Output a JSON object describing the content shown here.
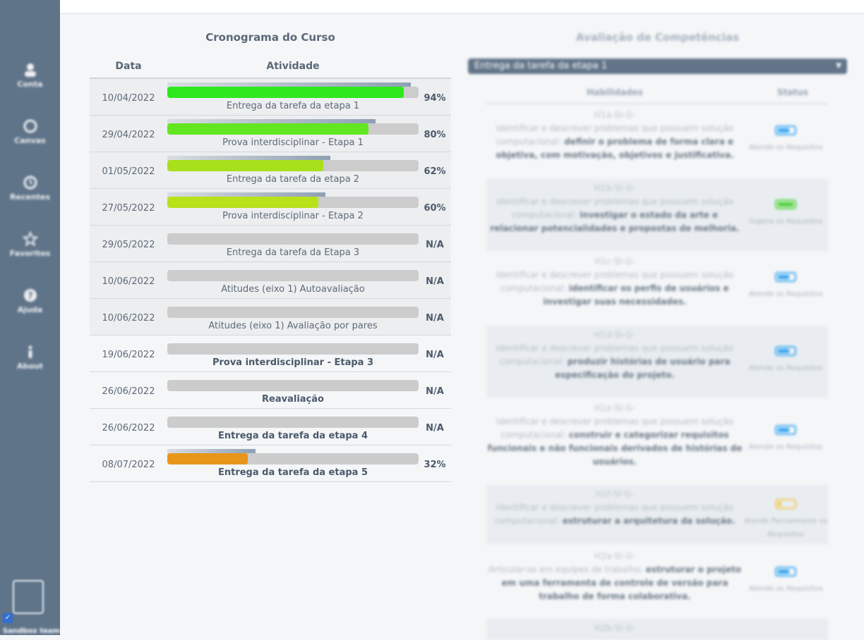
{
  "sidebar": {
    "items": [
      {
        "label": "Conta",
        "icon": "user-icon"
      },
      {
        "label": "Canvas",
        "icon": "circle-icon"
      },
      {
        "label": "Recentes",
        "icon": "clock-icon"
      },
      {
        "label": "Favoritos",
        "icon": "star-icon"
      },
      {
        "label": "Ajuda",
        "icon": "help-icon"
      },
      {
        "label": "About",
        "icon": "info-icon"
      }
    ],
    "bottom_label": "Sandbox team"
  },
  "schedule": {
    "title": "Cronograma do Curso",
    "col_date": "Data",
    "col_activity": "Atividade",
    "rows": [
      {
        "date": "10/04/2022",
        "activity": "Entrega da tarefa da etapa 1",
        "pct": "94%",
        "progress": 0.94,
        "reference": 0.97,
        "color": "#2ee81e",
        "bold": false,
        "shaded": true
      },
      {
        "date": "29/04/2022",
        "activity": "Prova interdisciplinar - Etapa 1",
        "pct": "80%",
        "progress": 0.8,
        "reference": 0.83,
        "color": "#62e61f",
        "bold": false,
        "shaded": true
      },
      {
        "date": "01/05/2022",
        "activity": "Entrega da tarefa da etapa 2",
        "pct": "62%",
        "progress": 0.62,
        "reference": 0.65,
        "color": "#a8e01c",
        "bold": false,
        "shaded": true
      },
      {
        "date": "27/05/2022",
        "activity": "Prova interdisciplinar - Etapa 2",
        "pct": "60%",
        "progress": 0.6,
        "reference": 0.63,
        "color": "#b8e21a",
        "bold": false,
        "shaded": true
      },
      {
        "date": "29/05/2022",
        "activity": "Entrega da tarefa da Etapa 3",
        "pct": "N/A",
        "progress": 0,
        "reference": 0,
        "color": "#cccccc",
        "bold": false,
        "shaded": true
      },
      {
        "date": "10/06/2022",
        "activity": "Atitudes (eixo 1) Autoavaliação",
        "pct": "N/A",
        "progress": 0,
        "reference": 0,
        "color": "#cccccc",
        "bold": false,
        "shaded": true
      },
      {
        "date": "10/06/2022",
        "activity": "Atitudes (eixo 1) Avaliação por pares",
        "pct": "N/A",
        "progress": 0,
        "reference": 0,
        "color": "#cccccc",
        "bold": false,
        "shaded": true
      },
      {
        "date": "19/06/2022",
        "activity": "Prova interdisciplinar - Etapa 3",
        "pct": "N/A",
        "progress": 0,
        "reference": 0,
        "color": "#cccccc",
        "bold": true,
        "shaded": false
      },
      {
        "date": "26/06/2022",
        "activity": "Reavaliação",
        "pct": "N/A",
        "progress": 0,
        "reference": 0,
        "color": "#cccccc",
        "bold": true,
        "shaded": false
      },
      {
        "date": "26/06/2022",
        "activity": "Entrega da tarefa da etapa 4",
        "pct": "N/A",
        "progress": 0,
        "reference": 0,
        "color": "#cccccc",
        "bold": true,
        "shaded": false
      },
      {
        "date": "08/07/2022",
        "activity": "Entrega da tarefa da etapa 5",
        "pct": "32%",
        "progress": 0.32,
        "reference": 0.35,
        "color": "#e8961a",
        "bold": true,
        "shaded": false
      }
    ]
  },
  "competencies": {
    "title": "Avaliação de Competências",
    "selected": "Entrega da tarefa da etapa 1",
    "col_skills": "Habilidades",
    "col_status": "Status",
    "items": [
      {
        "code": "H1a-SI-G-",
        "prefix": "Identificar e descrever problemas que possuem solução computacional:",
        "emphasis": "definir o problema de forma clara e objetiva, com motivação, objetivos e justificativa.",
        "status": "Atende os Requisitos",
        "level": "blue"
      },
      {
        "code": "H1b-SI-G-",
        "prefix": "Identificar e descrever problemas que possuem solução computacional:",
        "emphasis": "investigar o estado da arte e relacionar potencialidades e propostas de melhoria.",
        "status": "Supera os Requisitos",
        "level": "green"
      },
      {
        "code": "H1c-SI-G-",
        "prefix": "Identificar e descrever problemas que possuem solução computacional:",
        "emphasis": "identificar os perfis de usuários e investigar suas necessidades.",
        "status": "Atende os Requisitos",
        "level": "blue"
      },
      {
        "code": "H1d-SI-G-",
        "prefix": "Identificar e descrever problemas que possuem solução computacional:",
        "emphasis": "produzir histórias de usuário para especificação do projeto.",
        "status": "Atende os Requisitos",
        "level": "blue"
      },
      {
        "code": "H1e-SI-G-",
        "prefix": "Identificar e descrever problemas que possuem solução computacional:",
        "emphasis": "construir e categorizar requisitos funcionais e não funcionais derivados de histórias de usuários.",
        "status": "Atende os Requisitos",
        "level": "blue"
      },
      {
        "code": "H1f-SI-G-",
        "prefix": "Identificar e descrever problemas que possuem solução computacional:",
        "emphasis": "estruturar a arquitetura da solução.",
        "status": "Atende Parcialmente os Requisitos",
        "level": "yellow"
      },
      {
        "code": "H2a-SI-G-",
        "prefix": "Articular-se em equipes de trabalho:",
        "emphasis": "estruturar o projeto em uma ferramenta de controle de versão para trabalho de forma colaborativa.",
        "status": "Atende os Requisitos",
        "level": "blue"
      },
      {
        "code": "H2b-SI-G-",
        "prefix": "",
        "emphasis": "",
        "status": "",
        "level": "none"
      }
    ],
    "level_colors": {
      "blue": "#3aa7f0",
      "green": "#4cd437",
      "yellow": "#f2c94c",
      "none": "#cccccc"
    }
  }
}
